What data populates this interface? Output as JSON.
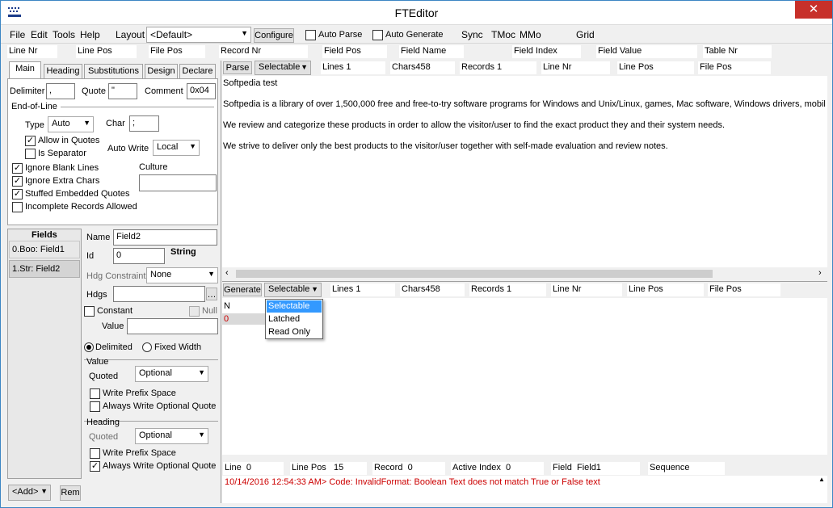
{
  "title": "FTEditor",
  "menu": {
    "file": "File",
    "edit": "Edit",
    "tools": "Tools",
    "help": "Help",
    "layout_label": "Layout",
    "layout_value": "<Default>",
    "configure": "Configure",
    "auto_parse": "Auto Parse",
    "auto_generate": "Auto Generate",
    "sync": "Sync",
    "tmoc": "TMoc",
    "mmo": "MMo",
    "grid": "Grid"
  },
  "header_fields": [
    "Line Nr",
    "Line Pos",
    "File Pos",
    "Record Nr",
    "Field Pos",
    "Field Name",
    "Field Index",
    "Field Value",
    "Table Nr"
  ],
  "tabs": [
    "Main",
    "Heading",
    "Substitutions",
    "Design",
    "Declare"
  ],
  "main": {
    "delimiter_label": "Delimiter",
    "delimiter_value": ",",
    "quote_label": "Quote",
    "quote_value": "\"",
    "comment_label": "Comment",
    "comment_value": "0x04",
    "eol_label": "End-of-Line",
    "type_label": "Type",
    "type_value": "Auto",
    "char_label": "Char",
    "char_value": ";",
    "allow_quotes": "Allow in Quotes",
    "is_separator": "Is Separator",
    "auto_write_label": "Auto Write",
    "auto_write_value": "Local",
    "ignore_blank": "Ignore Blank Lines",
    "culture_label": "Culture",
    "ignore_extra": "Ignore Extra Chars",
    "stuffed_quotes": "Stuffed Embedded Quotes",
    "incomplete": "Incomplete Records Allowed"
  },
  "fields": {
    "header": "Fields",
    "items": [
      "0.Boo: Field1",
      "1.Str: Field2"
    ],
    "add": "<Add>",
    "remove": "Rem"
  },
  "field_props": {
    "name_label": "Name",
    "name_value": "Field2",
    "id_label": "Id",
    "id_value": "0",
    "type_value": "String",
    "hdg_constraint_label": "Hdg Constraint",
    "hdg_constraint_value": "None",
    "hdgs_label": "Hdgs",
    "constant_label": "Constant",
    "null_label": "Null",
    "value_label": "Value",
    "delimited": "Delimited",
    "fixed_width": "Fixed Width",
    "value_section": "Value",
    "quoted_label": "Quoted",
    "quoted_value": "Optional",
    "write_prefix": "Write Prefix Space",
    "always_write": "Always Write Optional Quote",
    "heading_section": "Heading",
    "h_quoted_label": "Quoted",
    "h_quoted_value": "Optional",
    "h_write_prefix": "Write Prefix Space",
    "h_always_write": "Always Write Optional Quote"
  },
  "parse_bar": {
    "button": "Parse",
    "mode": "Selectable",
    "lines": "Lines",
    "lines_value": "1",
    "chars": "Chars458",
    "records": "Records",
    "records_value": "1",
    "line_nr": "Line Nr",
    "line_pos": "Line Pos",
    "file_pos": "File Pos"
  },
  "text_lines": [
    "Softpedia test",
    "Softpedia is a library of over 1,500,000 free and free-to-try software programs for Windows and Unix/Linux, games, Mac software, Windows drivers, mobil",
    "We review and categorize these products in order to allow the visitor/user to find the exact product they and their system needs.",
    "We strive to deliver only the best products to the visitor/user together with self-made evaluation and review notes."
  ],
  "gen_bar": {
    "button": "Generate",
    "mode": "Selectable",
    "lines": "Lines",
    "lines_value": "1",
    "chars": "Chars458",
    "records": "Records",
    "records_value": "1",
    "line_nr": "Line Nr",
    "line_pos": "Line Pos",
    "file_pos": "File Pos"
  },
  "dropdown_options": [
    "Selectable",
    "Latched",
    "Read Only"
  ],
  "grid": {
    "col": "N",
    "val": "0"
  },
  "status": {
    "line": "Line",
    "line_value": "0",
    "line_pos": "Line Pos",
    "line_pos_value": "15",
    "record": "Record",
    "record_value": "0",
    "active_index": "Active Index",
    "active_index_value": "0",
    "field": "Field",
    "field_value": "Field1",
    "sequence": "Sequence"
  },
  "error_text": "10/14/2016 12:54:33 AM> Code: InvalidFormat: Boolean Text does not match True or False text",
  "colors": {
    "error": "#cc0000",
    "selection": "#3399ff",
    "close": "#c7302a"
  }
}
